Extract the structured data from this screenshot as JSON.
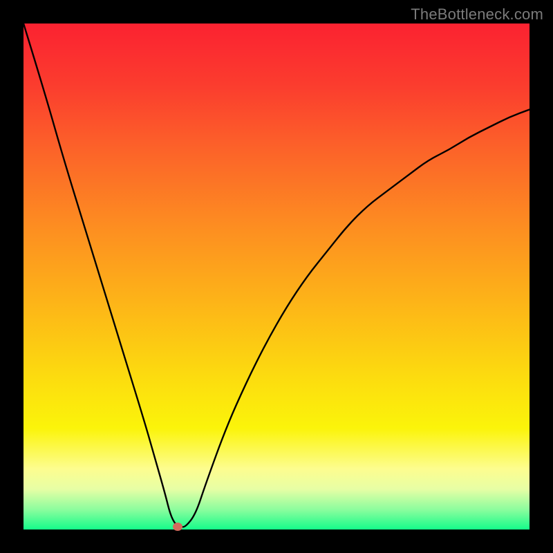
{
  "watermark": "TheBottleneck.com",
  "colors": {
    "frame": "#000000",
    "gradient_top": "#fb2231",
    "gradient_bottom": "#15fc8a",
    "curve": "#000000",
    "marker": "#d36a5d",
    "watermark_text": "#7b7b7b"
  },
  "chart_data": {
    "type": "line",
    "title": "",
    "xlabel": "",
    "ylabel": "",
    "xlim": [
      0,
      100
    ],
    "ylim": [
      0,
      100
    ],
    "grid": false,
    "legend": false,
    "notes": "Plot background is a vertical gradient from red (high y) through orange/yellow to green (y≈0). Curve is a black V-shaped line with a steep near-linear left descent from top-left to a minimum around x≈30, y≈0, flattens briefly, then a concave right branch rising toward top-right. A small reddish marker sits at the curve minimum.",
    "series": [
      {
        "name": "curve",
        "x": [
          0,
          4,
          8,
          12,
          16,
          20,
          24,
          26,
          28,
          29,
          30,
          31,
          32,
          34,
          36,
          40,
          44,
          48,
          52,
          56,
          60,
          64,
          68,
          72,
          76,
          80,
          84,
          88,
          92,
          96,
          100
        ],
        "y": [
          100,
          87,
          73,
          60,
          47,
          34,
          21,
          14,
          7,
          3,
          1,
          0.5,
          0.5,
          3,
          9,
          20,
          29,
          37,
          44,
          50,
          55,
          60,
          64,
          67,
          70,
          73,
          75,
          77.5,
          79.5,
          81.5,
          83
        ]
      }
    ],
    "marker": {
      "x": 30.5,
      "y": 0.5
    }
  }
}
